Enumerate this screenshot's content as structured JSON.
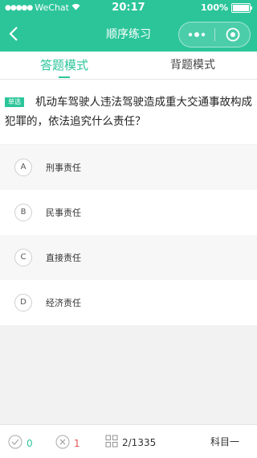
{
  "status_bar": {
    "carrier": "WeChat",
    "time": "20:17",
    "battery": "100%"
  },
  "nav": {
    "title": "顺序练习"
  },
  "tabs": [
    {
      "label": "答题模式",
      "active": true
    },
    {
      "label": "背题模式",
      "active": false
    }
  ],
  "question": {
    "type_badge": "单选",
    "text": "机动车驾驶人违法驾驶造成重大交通事故构成犯罪的，依法追究什么责任？"
  },
  "options": [
    {
      "key": "A",
      "text": "刑事责任"
    },
    {
      "key": "B",
      "text": "民事责任"
    },
    {
      "key": "C",
      "text": "直接责任"
    },
    {
      "key": "D",
      "text": "经济责任"
    }
  ],
  "bottom_bar": {
    "correct_count": "0",
    "wrong_count": "1",
    "progress": "2/1335",
    "subject": "科目一"
  },
  "colors": {
    "accent": "#2cc59a",
    "wrong": "#e05555"
  },
  "icons": [
    "back-icon",
    "more-icon",
    "close-circle-icon",
    "check-icon",
    "cross-icon",
    "grid-icon",
    "wifi-icon",
    "battery-icon"
  ]
}
